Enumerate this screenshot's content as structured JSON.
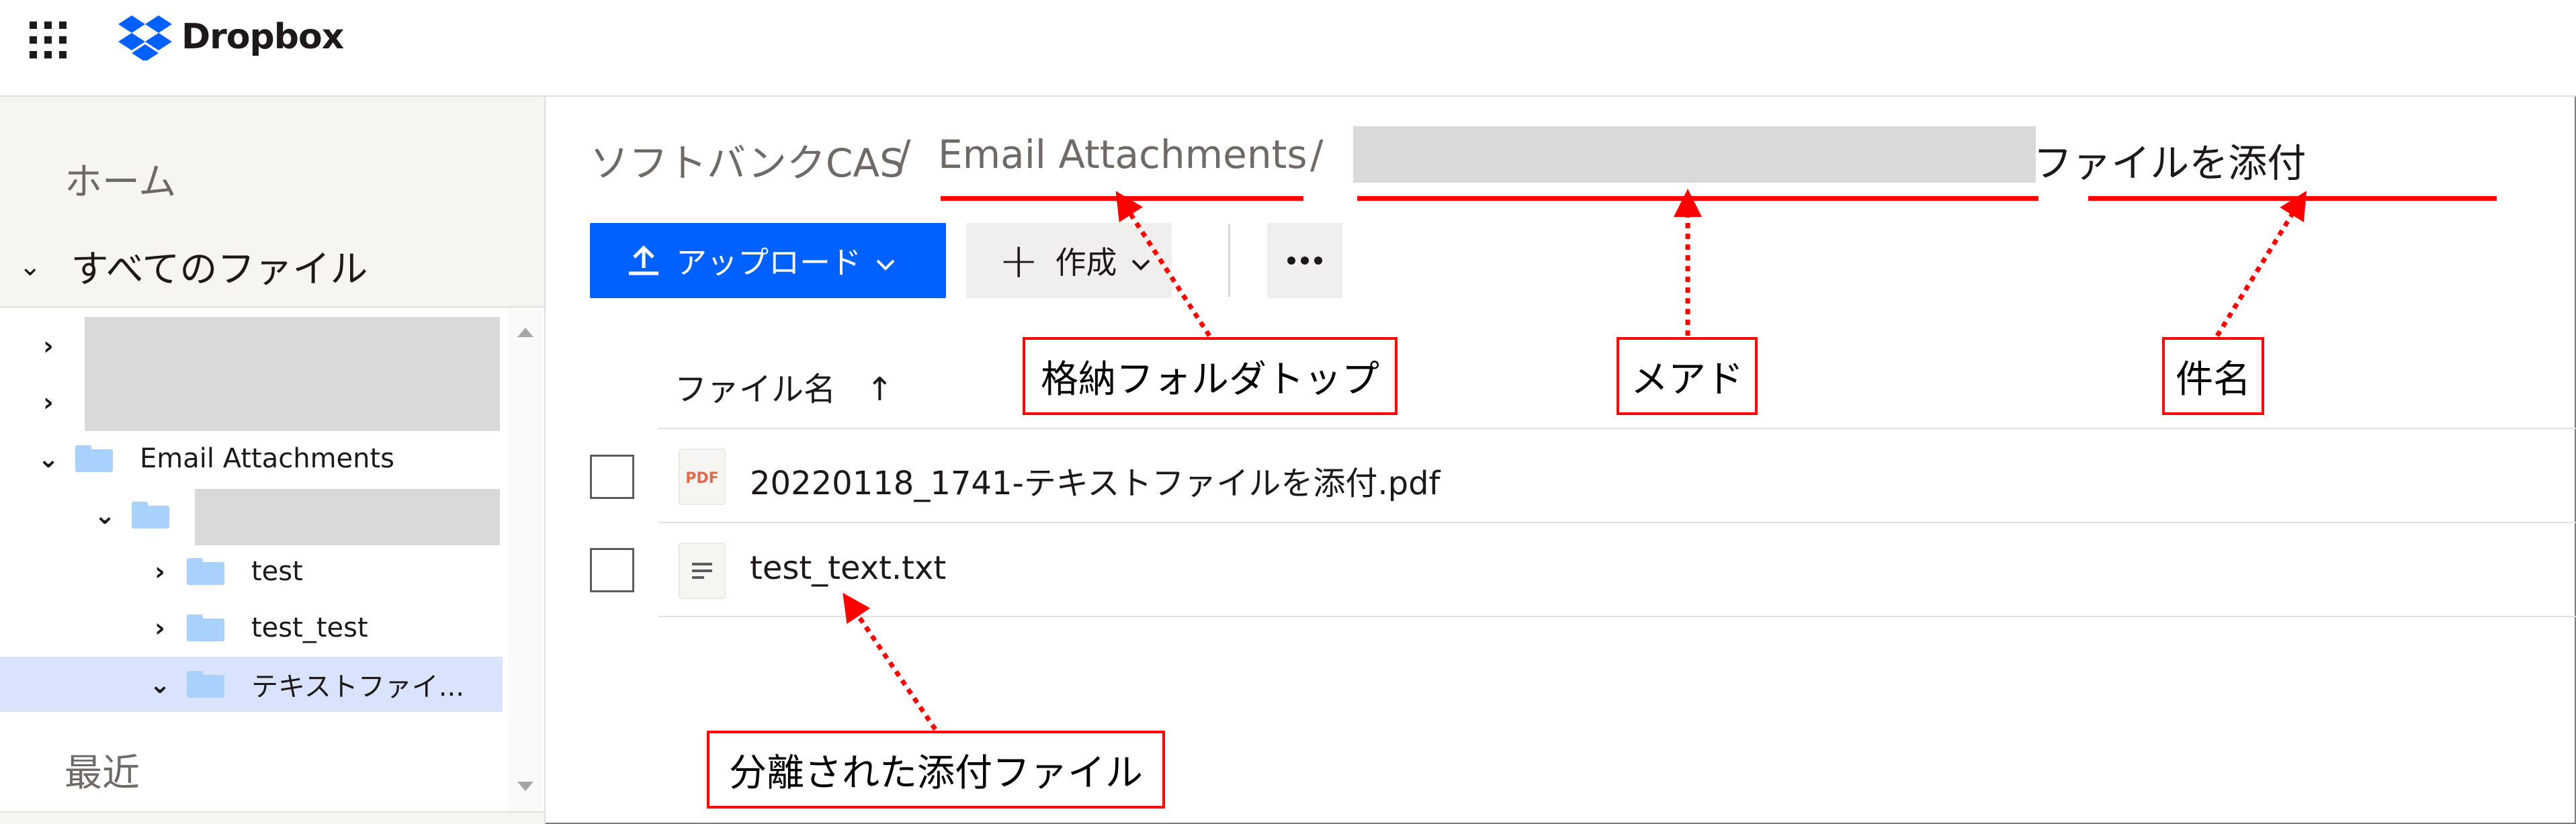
{
  "app": {
    "name": "Dropbox",
    "brand_color": "#0061fe"
  },
  "sidebar": {
    "home": "ホーム",
    "all_files": "すべてのファイル",
    "tree": [
      {
        "label": "",
        "redacted": true,
        "expanded": false
      },
      {
        "label": "",
        "redacted": true,
        "expanded": false
      },
      {
        "label": "Email Attachments",
        "expanded": true
      },
      {
        "label": "",
        "redacted": true,
        "expanded": true
      },
      {
        "label": "test",
        "expanded": false
      },
      {
        "label": "test_test",
        "expanded": false
      },
      {
        "label": "テキストファイ...",
        "expanded": true,
        "selected": true
      }
    ],
    "recent": "最近"
  },
  "breadcrumb": {
    "root": "ソフトバンクCAS",
    "sep": "/",
    "folder": "Email Attachments",
    "redacted_segment": "",
    "current": "テキストファイルを添付"
  },
  "toolbar": {
    "upload_label": "アップロード",
    "create_label": "作成"
  },
  "file_list": {
    "column_name": "ファイル名",
    "sort_indicator": "↑",
    "files": [
      {
        "name": "20220118_1741-テキストファイルを添付.pdf",
        "icon": "pdf-icon",
        "icon_text": "PDF"
      },
      {
        "name": "test_text.txt",
        "icon": "text-file-icon"
      }
    ]
  },
  "annotations": {
    "color": "#ff0000",
    "top_folder": "格納フォルダトップ",
    "email_address": "メアド",
    "subject": "件名",
    "separated_attachment": "分離された添付ファイル"
  }
}
